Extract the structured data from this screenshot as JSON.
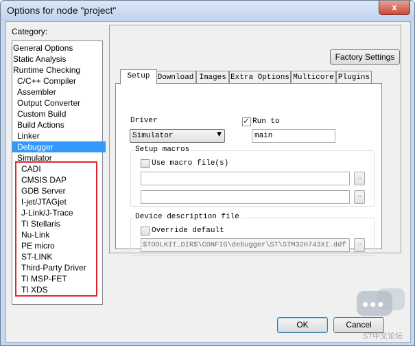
{
  "window": {
    "title": "Options for node \"project\"",
    "close_label": "x"
  },
  "category": {
    "label": "Category:",
    "items": [
      {
        "label": "General Options"
      },
      {
        "label": "Static Analysis"
      },
      {
        "label": "Runtime Checking"
      },
      {
        "label": "C/C++ Compiler"
      },
      {
        "label": "Assembler"
      },
      {
        "label": "Output Converter"
      },
      {
        "label": "Custom Build"
      },
      {
        "label": "Build Actions"
      },
      {
        "label": "Linker"
      },
      {
        "label": "Debugger",
        "selected": true
      },
      {
        "label": "Simulator"
      },
      {
        "label": "CADI"
      },
      {
        "label": "CMSIS DAP"
      },
      {
        "label": "GDB Server"
      },
      {
        "label": "I-jet/JTAGjet"
      },
      {
        "label": "J-Link/J-Trace"
      },
      {
        "label": "TI Stellaris"
      },
      {
        "label": "Nu-Link"
      },
      {
        "label": "PE micro"
      },
      {
        "label": "ST-LINK"
      },
      {
        "label": "Third-Party Driver"
      },
      {
        "label": "TI MSP-FET"
      },
      {
        "label": "TI XDS"
      }
    ],
    "highlight_color": "#e0262b"
  },
  "factory_settings_label": "Factory Settings",
  "tabs": [
    {
      "label": "Setup",
      "active": true
    },
    {
      "label": "Download"
    },
    {
      "label": "Images"
    },
    {
      "label": "Extra Options"
    },
    {
      "label": "Multicore"
    },
    {
      "label": "Plugins"
    }
  ],
  "setup": {
    "driver_label": "Driver",
    "driver_value": "Simulator",
    "run_to": {
      "label": "Run to",
      "checked": true,
      "value": "main"
    },
    "setup_macros": {
      "title": "Setup macros",
      "use_macro_label": "Use macro file(s)",
      "checked": false,
      "file1": "",
      "file2": "",
      "browse_label": ".."
    },
    "device_description": {
      "title": "Device description file",
      "override_label": "Override default",
      "checked": false,
      "path": "$TOOLKIT_DIR$\\CONFIG\\debugger\\ST\\STM32H743XI.ddf",
      "browse_label": ".."
    }
  },
  "buttons": {
    "ok": "OK",
    "cancel": "Cancel"
  },
  "watermark": {
    "text": "ST中文论坛"
  }
}
